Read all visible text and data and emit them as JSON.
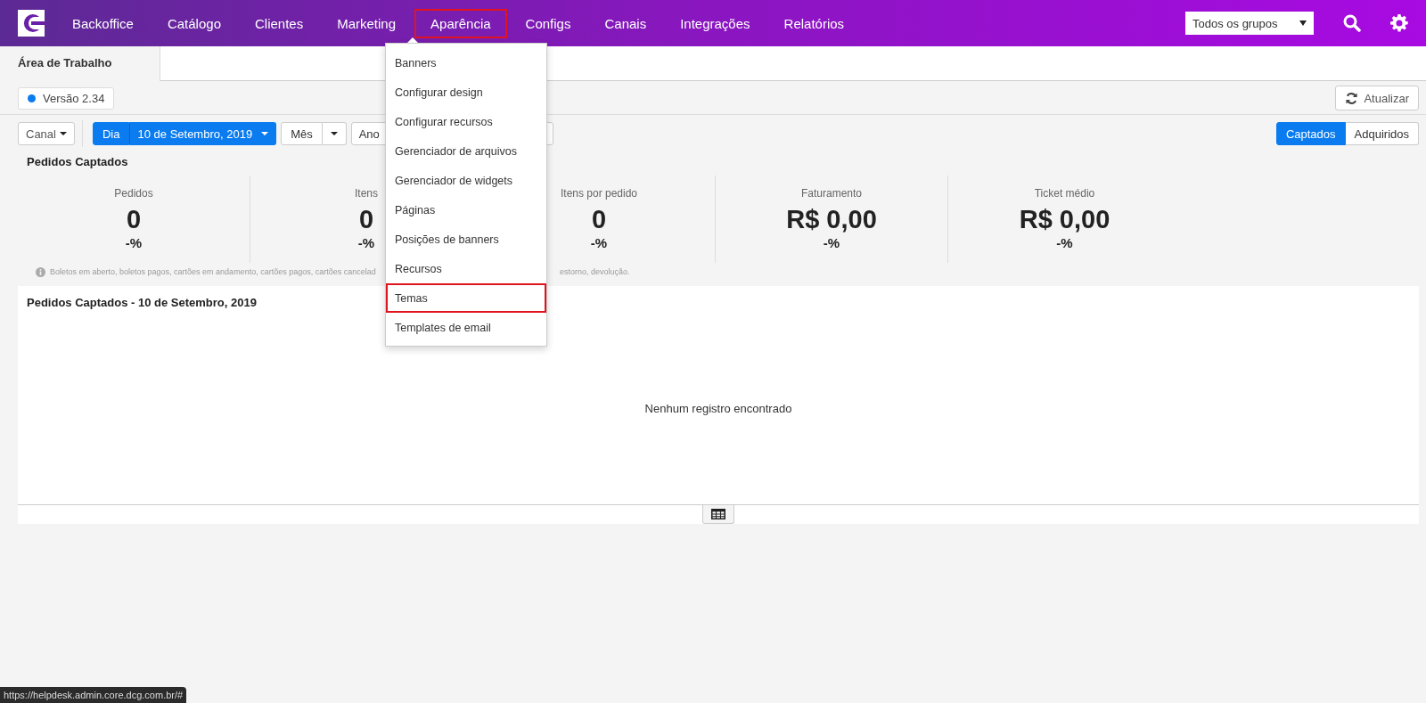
{
  "navbar": {
    "items": [
      {
        "label": "Backoffice",
        "selected": false
      },
      {
        "label": "Catálogo",
        "selected": false
      },
      {
        "label": "Clientes",
        "selected": false
      },
      {
        "label": "Marketing",
        "selected": false
      },
      {
        "label": "Aparência",
        "selected": true
      },
      {
        "label": "Configs",
        "selected": false
      },
      {
        "label": "Canais",
        "selected": false
      },
      {
        "label": "Integrações",
        "selected": false
      },
      {
        "label": "Relatórios",
        "selected": false
      }
    ],
    "group_select": {
      "value": "Todos os grupos"
    }
  },
  "dropdown_menu": {
    "items": [
      {
        "label": "Banners",
        "highlighted": false
      },
      {
        "label": "Configurar design",
        "highlighted": false
      },
      {
        "label": "Configurar recursos",
        "highlighted": false
      },
      {
        "label": "Gerenciador de arquivos",
        "highlighted": false
      },
      {
        "label": "Gerenciador de widgets",
        "highlighted": false
      },
      {
        "label": "Páginas",
        "highlighted": false
      },
      {
        "label": "Posições de banners",
        "highlighted": false
      },
      {
        "label": "Recursos",
        "highlighted": false
      },
      {
        "label": "Temas",
        "highlighted": true
      },
      {
        "label": "Templates de email",
        "highlighted": false
      }
    ]
  },
  "tabs": [
    {
      "label": "Área de Trabalho",
      "selected": true
    }
  ],
  "version_badge": {
    "label": "Versão 2.34"
  },
  "refresh_button": {
    "label": "Atualizar"
  },
  "filters": {
    "channel": "Canal",
    "periods": [
      {
        "label": "Dia",
        "kind": "date",
        "selected": true,
        "date": "10 de Setembro, 2019"
      },
      {
        "label": "Mês",
        "kind": "split",
        "selected": false
      },
      {
        "label": "Ano",
        "kind": "plain",
        "selected": false
      }
    ],
    "modes": [
      {
        "label": "Captados",
        "selected": true
      },
      {
        "label": "Adquiridos",
        "selected": false
      }
    ]
  },
  "summary": {
    "title": "Pedidos Captados",
    "stats": [
      {
        "label": "Pedidos",
        "value": "0",
        "change": "-%"
      },
      {
        "label": "Itens",
        "value": "0",
        "change": "-%"
      },
      {
        "label": "Itens por pedido",
        "value": "0",
        "change": "-%"
      },
      {
        "label": "Faturamento",
        "value": "R$ 0,00",
        "change": "-%"
      },
      {
        "label": "Ticket médio",
        "value": "R$ 0,00",
        "change": "-%"
      }
    ],
    "note": [
      "Boletos em aberto, boletos pagos, cartões em andamento, cartões pagos, cartões cancelad",
      "estorno, devolução."
    ]
  },
  "chart_panel": {
    "title": "Pedidos Captados - 10 de Setembro, 2019",
    "empty_message": "Nenhum registro encontrado"
  },
  "status_url": "https://helpdesk.admin.core.dcg.com.br/#"
}
